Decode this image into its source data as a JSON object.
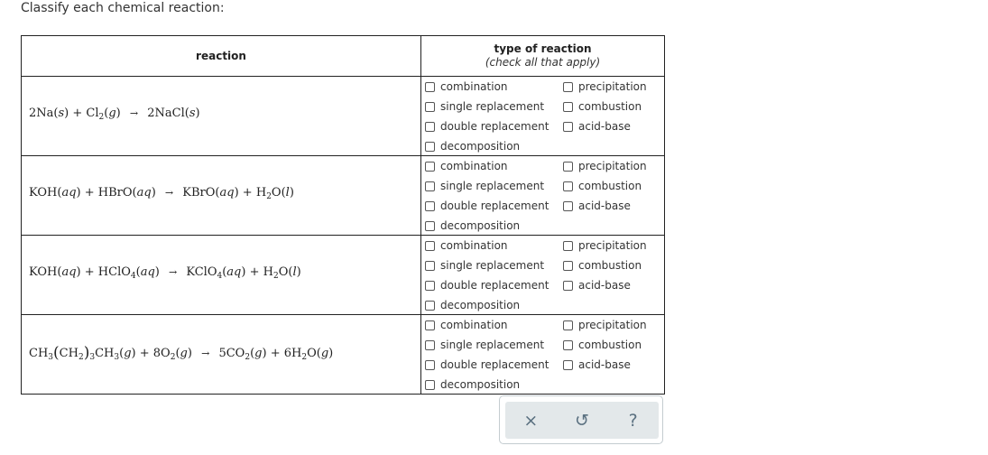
{
  "prompt": "Classify each chemical reaction:",
  "table": {
    "header_reaction": "reaction",
    "header_type": "type of reaction",
    "header_type_note": "(check all that apply)"
  },
  "options": {
    "combination": "combination",
    "single_replacement": "single replacement",
    "double_replacement": "double replacement",
    "decomposition": "decomposition",
    "precipitation": "precipitation",
    "combustion": "combustion",
    "acid_base": "acid-base"
  },
  "reactions": [
    {
      "text": "2Na(s) + Cl2(g) → 2NaCl(s)",
      "checked": []
    },
    {
      "text": "KOH(aq) + HBrO(aq) → KBrO(aq) + H2O(l)",
      "checked": []
    },
    {
      "text": "KOH(aq) + HClO4(aq) → KClO4(aq) + H2O(l)",
      "checked": []
    },
    {
      "text": "CH3(CH2)3CH3(g) + 8O2(g) → 5CO2(g) + 6H2O(g)",
      "checked": []
    }
  ],
  "eq_parts": {
    "plus": "+",
    "arrow": "→",
    "s": "s",
    "g": "g",
    "aq": "aq",
    "l": "l",
    "r1": {
      "a": "2Na",
      "b": "Cl",
      "b_sub": "2",
      "c": "2NaCl"
    },
    "r2": {
      "a": "KOH",
      "b": "HBrO",
      "c": "KBrO",
      "d": "H",
      "d_sub": "2",
      "d2": "O"
    },
    "r3": {
      "a": "KOH",
      "b": "HClO",
      "b_sub": "4",
      "c": "KClO",
      "c_sub": "4",
      "d": "H",
      "d_sub": "2",
      "d2": "O"
    },
    "r4": {
      "a1": "CH",
      "a1_sub": "3",
      "a2": "CH",
      "a2_sub": "2",
      "a3_sub": "3",
      "a4": "CH",
      "a4_sub": "3",
      "b": "8O",
      "b_sub": "2",
      "c": "5CO",
      "c_sub": "2",
      "d": "6H",
      "d_sub": "2",
      "d2": "O"
    }
  },
  "actions": {
    "clear": "×",
    "reset": "↺",
    "help": "?"
  }
}
